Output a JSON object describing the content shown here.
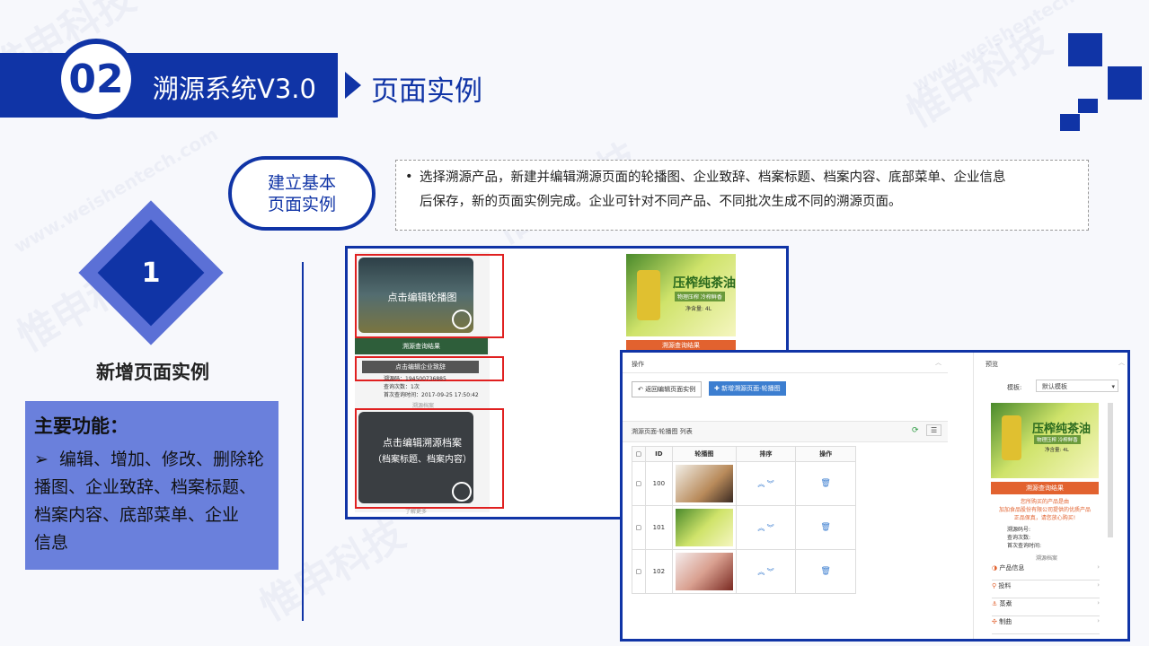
{
  "header": {
    "number": "02",
    "title": "溯源系统V3.0",
    "subtitle": "页面实例"
  },
  "build": {
    "line1": "建立基本",
    "line2": "页面实例",
    "bullet": "•",
    "desc_line1": "选择溯源产品，新建并编辑溯源页面的轮播图、企业致辞、档案标题、档案内容、底部菜单、企业信息",
    "desc_line2": "后保存，新的页面实例完成。企业可针对不同产品、不同批次生成不同的溯源页面。"
  },
  "step": {
    "number": "1",
    "title": "新增页面实例"
  },
  "functions": {
    "heading": "主要功能：",
    "bullet": "➢",
    "line1": "编辑、增加、修改、删除轮",
    "line2": "播图、企业致辞、档案标题、",
    "line3": "档案内容、底部菜单、企业",
    "line4": "信息"
  },
  "watermarks": {
    "brand": "惟申科技",
    "url": "www.weishentech.com"
  },
  "shot1": {
    "edit_carousel": "点击编辑轮播图",
    "query_result": "溯源查询结果",
    "edit_company": "点击编辑企业致辞",
    "trace_code": "溯源码：194500736885",
    "query_count": "查询次数：1次",
    "first_query": "首次查询时间：2017-09-25 17:50:42",
    "archive_label": "溯源档案",
    "edit_archive": "点击编辑溯源档案",
    "archive_hint": "（档案标题、档案内容）",
    "more": "了解更多",
    "oil_title": "压榨纯茶油",
    "oil_sub": "物理压榨 冷榨鲜香",
    "oil_net": "净含量: 4L",
    "query_result2": "溯源查询结果"
  },
  "shot2": {
    "ops_label": "操作",
    "back_btn": "返回编辑页面实例",
    "new_btn": "新增溯源页面-轮播图",
    "list_title": "溯源页面-轮播图 列表",
    "col_id": "ID",
    "col_img": "轮播图",
    "col_sort": "排序",
    "col_op": "操作",
    "rows": [
      {
        "id": "100"
      },
      {
        "id": "101"
      },
      {
        "id": "102"
      }
    ],
    "preview_label": "预览",
    "template_label": "模板:",
    "template_value": "默认模板",
    "oil_title": "压榨纯茶油",
    "oil_sub": "物理压榨 冷榨鲜香",
    "oil_net": "净含量: 4L",
    "query_result": "溯源查询结果",
    "thanks1": "您所购买的产品是由",
    "thanks2": "加加食品股份有限公司提供的优质产品",
    "thanks3": "正品保真，请您放心购买!",
    "trace_code": "溯源码号:",
    "query_count": "查询次数:",
    "first_query": "首次查询时间:",
    "archive_label": "溯源档案",
    "menu": [
      "产品信息",
      "投料",
      "蒸煮",
      "制曲"
    ]
  }
}
